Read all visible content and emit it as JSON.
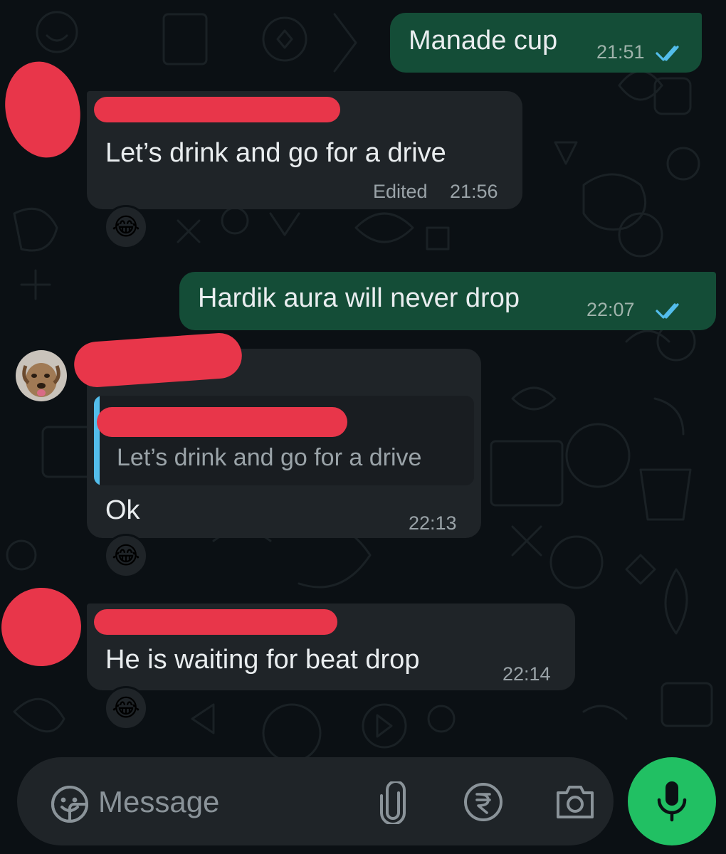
{
  "messages": [
    {
      "id": "m1",
      "direction": "outgoing",
      "text": "Manade cup",
      "time": "21:51",
      "status": "read"
    },
    {
      "id": "m2",
      "direction": "incoming",
      "text": "Let’s drink and go for a drive",
      "edited_label": "Edited",
      "time": "21:56",
      "reaction": "😂"
    },
    {
      "id": "m3",
      "direction": "outgoing",
      "text": "Hardik aura will never drop",
      "time": "22:07",
      "status": "read"
    },
    {
      "id": "m4",
      "direction": "incoming",
      "quoted_text": "Let’s drink and go for a drive",
      "text": "Ok",
      "time": "22:13",
      "reaction": "😂"
    },
    {
      "id": "m5",
      "direction": "incoming",
      "text": "He is waiting for beat drop",
      "time": "22:14",
      "reaction": "😂"
    }
  ],
  "composer": {
    "placeholder": "Message",
    "icons": [
      "sticker-icon",
      "attach-icon",
      "rupee-payment-icon",
      "camera-icon",
      "microphone-icon"
    ]
  },
  "colors": {
    "background": "#0b1014",
    "outgoing_bubble": "#144d37",
    "incoming_bubble": "#1f2428",
    "read_tick": "#53bdeb",
    "mic_button": "#21c063",
    "redaction": "#e8364a"
  }
}
